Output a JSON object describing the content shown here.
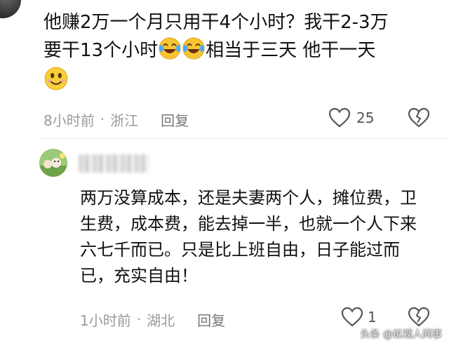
{
  "comment1": {
    "line1": "他赚2万一个月只用干4个小时？我干2-3万",
    "line2_before": "要干13个小时",
    "line2_after": "相当于三天 他干一天",
    "emojis": [
      "laughing-crying-emoji",
      "laughing-crying-emoji",
      "smile-emoji"
    ],
    "time": "8小时前",
    "separator": "·",
    "location": "浙江",
    "reply_label": "回复",
    "like_count": "25"
  },
  "comment2": {
    "author_name_blurred": true,
    "text": "两万没算成本，还是夫妻两个人，摊位费，卫生费，成本费，能去掉一半，也就一个人下来六七千而已。只是比上班自由，日子能过而已，充实自由！",
    "time": "1小时前",
    "separator": "·",
    "location": "湖北",
    "reply_label": "回复",
    "like_count": "1"
  },
  "watermark": {
    "text": "头条 @纵观人间事"
  },
  "colors": {
    "text": "#111111",
    "meta": "#9a9a9a",
    "icon": "#555555"
  }
}
